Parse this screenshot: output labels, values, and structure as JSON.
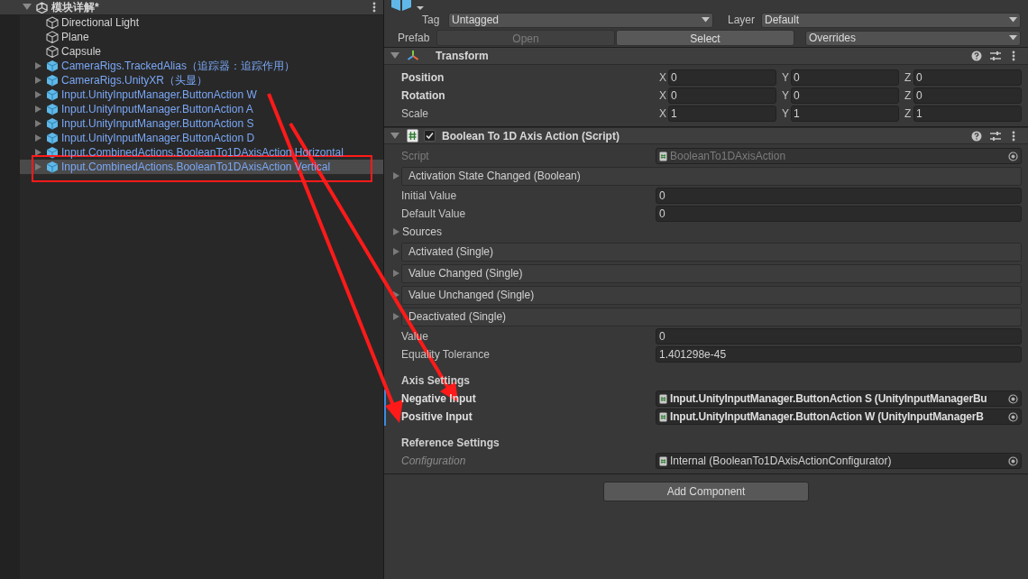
{
  "hierarchy": {
    "scene": {
      "title": "模块详解*",
      "expanded": true
    },
    "items": [
      {
        "label": "Directional Light",
        "kind": "object",
        "expandable": false,
        "selected": false
      },
      {
        "label": "Plane",
        "kind": "object",
        "expandable": false,
        "selected": false
      },
      {
        "label": "Capsule",
        "kind": "object",
        "expandable": false,
        "selected": false
      },
      {
        "label": "CameraRigs.TrackedAlias（追踪器：追踪作用）",
        "kind": "prefab",
        "expandable": true,
        "selected": false
      },
      {
        "label": "CameraRigs.UnityXR（头显）",
        "kind": "prefab",
        "expandable": true,
        "selected": false
      },
      {
        "label": "Input.UnityInputManager.ButtonAction W",
        "kind": "prefab",
        "expandable": true,
        "selected": false
      },
      {
        "label": "Input.UnityInputManager.ButtonAction A",
        "kind": "prefab",
        "expandable": true,
        "selected": false
      },
      {
        "label": "Input.UnityInputManager.ButtonAction S",
        "kind": "prefab",
        "expandable": true,
        "selected": false
      },
      {
        "label": "Input.UnityInputManager.ButtonAction D",
        "kind": "prefab",
        "expandable": true,
        "selected": false
      },
      {
        "label": "Input.CombinedActions.BooleanTo1DAxisAction Horizontal",
        "kind": "prefab",
        "expandable": true,
        "selected": false
      },
      {
        "label": "Input.CombinedActions.BooleanTo1DAxisAction Vertical",
        "kind": "prefab",
        "expandable": true,
        "selected": true
      }
    ]
  },
  "inspector": {
    "tag": {
      "label": "Tag",
      "value": "Untagged"
    },
    "layer": {
      "label": "Layer",
      "value": "Default"
    },
    "prefab": {
      "label": "Prefab",
      "buttons": [
        {
          "label": "Open",
          "disabled": true
        },
        {
          "label": "Select",
          "disabled": false
        }
      ],
      "overrides": "Overrides"
    },
    "components": [
      {
        "kind": "transform",
        "title": "Transform",
        "expanded": true,
        "rows": [
          {
            "label": "Position",
            "bold": true,
            "values": [
              {
                "axis": "X",
                "value": "0"
              },
              {
                "axis": "Y",
                "value": "0"
              },
              {
                "axis": "Z",
                "value": "0"
              }
            ]
          },
          {
            "label": "Rotation",
            "bold": true,
            "values": [
              {
                "axis": "X",
                "value": "0"
              },
              {
                "axis": "Y",
                "value": "0"
              },
              {
                "axis": "Z",
                "value": "0"
              }
            ]
          },
          {
            "label": "Scale",
            "bold": false,
            "values": [
              {
                "axis": "X",
                "value": "1"
              },
              {
                "axis": "Y",
                "value": "1"
              },
              {
                "axis": "Z",
                "value": "1"
              }
            ]
          }
        ]
      },
      {
        "kind": "script",
        "title": "Boolean To 1D Axis Action (Script)",
        "expanded": true,
        "enabled": true,
        "fields": [
          {
            "kind": "object",
            "label": "Script",
            "value": "BooleanTo1DAxisAction",
            "disabled": true,
            "modified": false,
            "italic": false
          },
          {
            "kind": "event",
            "label": "Activation State Changed (Boolean)"
          },
          {
            "kind": "number",
            "label": "Initial Value",
            "value": "0"
          },
          {
            "kind": "number",
            "label": "Default Value",
            "value": "0"
          },
          {
            "kind": "foldout",
            "label": "Sources",
            "expanded": false
          },
          {
            "kind": "event",
            "label": "Activated (Single)"
          },
          {
            "kind": "event",
            "label": "Value Changed (Single)"
          },
          {
            "kind": "event",
            "label": "Value Unchanged (Single)"
          },
          {
            "kind": "event",
            "label": "Deactivated (Single)"
          },
          {
            "kind": "number",
            "label": "Value",
            "value": "0"
          },
          {
            "kind": "number",
            "label": "Equality Tolerance",
            "value": "1.401298e-45"
          },
          {
            "kind": "header",
            "label": "Axis Settings"
          },
          {
            "kind": "object",
            "label": "Negative Input",
            "value": "Input.UnityInputManager.ButtonAction S (UnityInputManagerBu",
            "disabled": false,
            "modified": true,
            "italic": false
          },
          {
            "kind": "object",
            "label": "Positive Input",
            "value": "Input.UnityInputManager.ButtonAction W (UnityInputManagerB",
            "disabled": false,
            "modified": true,
            "italic": false
          },
          {
            "kind": "header",
            "label": "Reference Settings"
          },
          {
            "kind": "object",
            "label": "Configuration",
            "value": "Internal (BooleanTo1DAxisActionConfigurator)",
            "disabled": false,
            "modified": false,
            "italic": true
          }
        ]
      }
    ],
    "add_component": "Add Component"
  }
}
